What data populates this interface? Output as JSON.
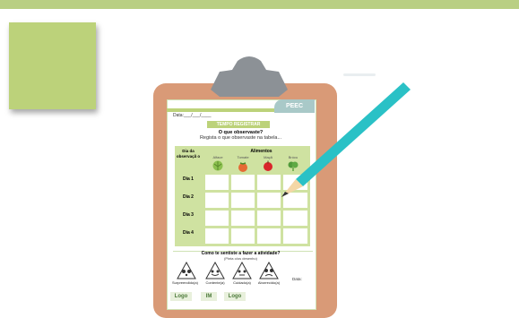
{
  "worksheet": {
    "corner_tab": "PEEC",
    "date_line": "Data:___/___/____",
    "title_pill": "TEMPO REGISTRAR",
    "question_title": "O que observaste?",
    "question_subtitle": "Regista o que observaste na tabela...",
    "table": {
      "day_header": "Dia da observaçã o",
      "food_header": "Alimentos",
      "foods": [
        "Alface",
        "Tomate",
        "Maçã",
        "Brócu"
      ],
      "days": [
        "Dia 1",
        "Dia 2",
        "Dia 3",
        "Dia 4"
      ]
    },
    "feelings": {
      "question": "Como te sentiste a fazer a atividade?",
      "hint": "(Pinta o/os desenho)",
      "moods": [
        "Surpreendido(a)",
        "Contente(a)",
        "Cuidado(a)",
        "Aborrecido(a)"
      ],
      "date_label": "Data:"
    },
    "footer_logos": [
      "Logo",
      "IM",
      "Logo"
    ]
  },
  "colors": {
    "band": "#b9cf83",
    "board": "#d99a77",
    "accent_green": "#bcd27a",
    "pencil": "#2ac1c6"
  }
}
